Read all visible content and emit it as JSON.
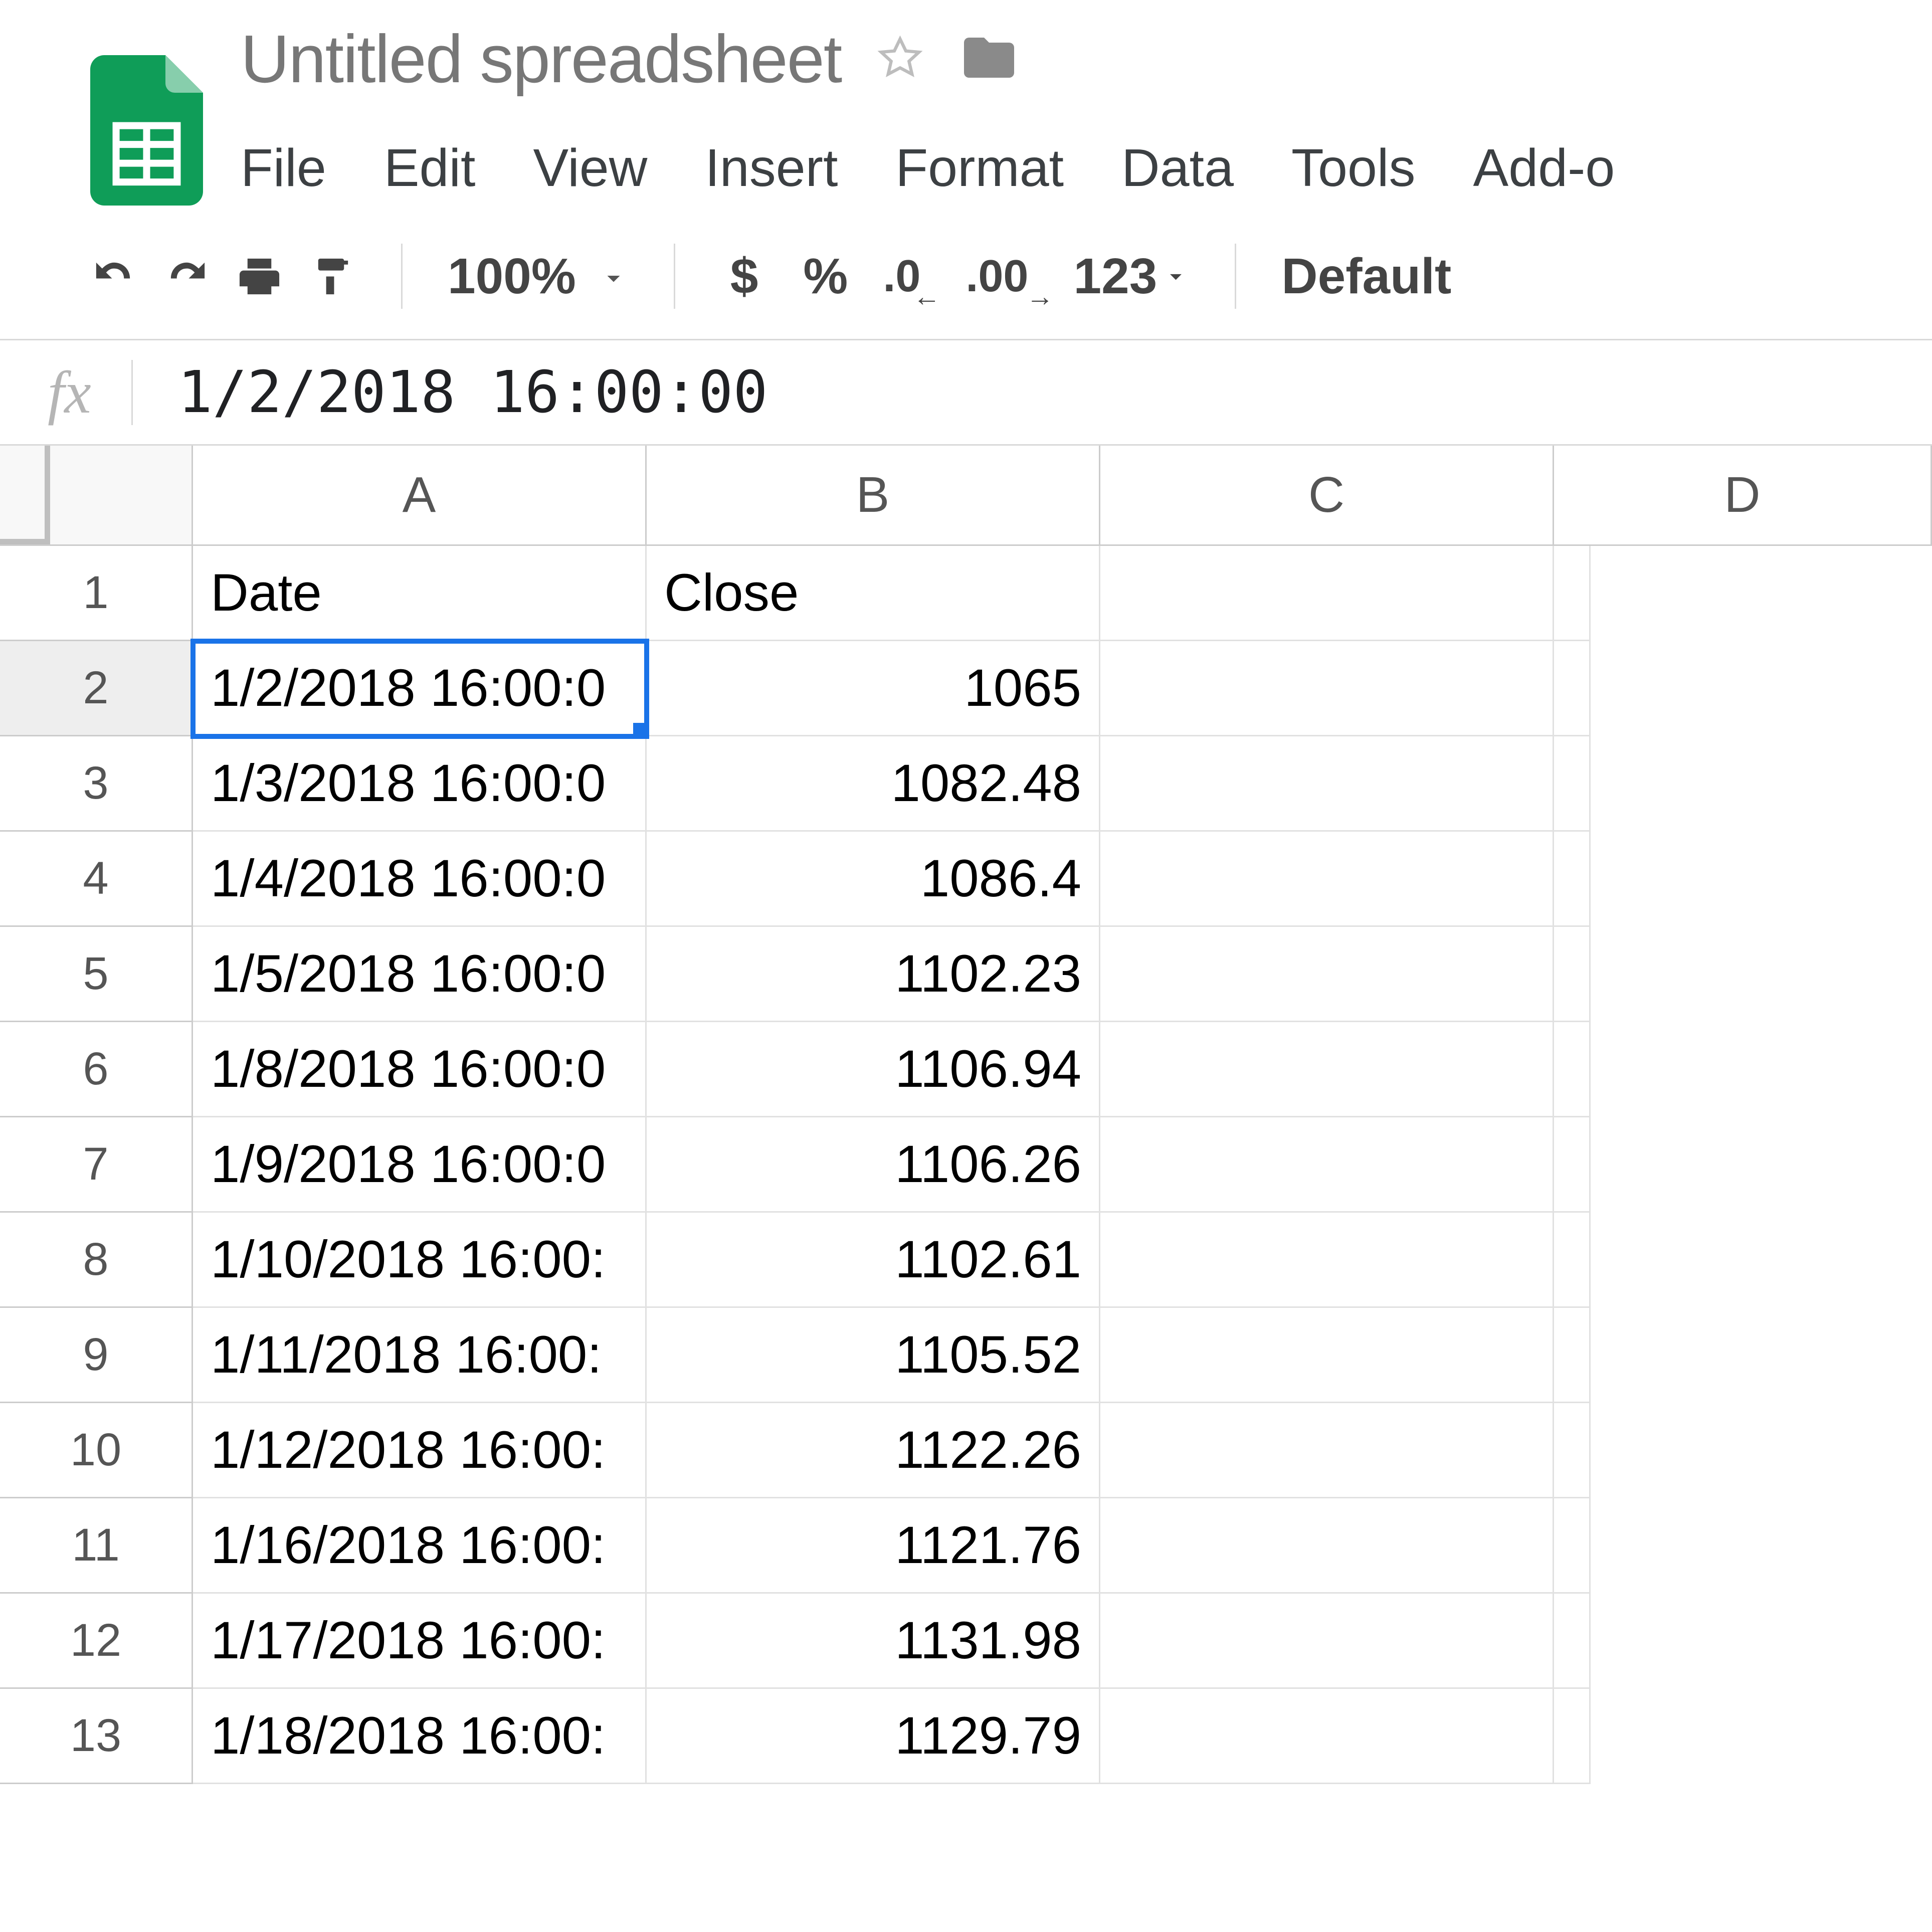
{
  "doc": {
    "name": "Untitled spreadsheet"
  },
  "menu": {
    "file": "File",
    "edit": "Edit",
    "view": "View",
    "insert": "Insert",
    "format": "Format",
    "data": "Data",
    "tools": "Tools",
    "addons": "Add-o"
  },
  "toolbar": {
    "zoom": "100%",
    "currency": "$",
    "percent": "%",
    "decrease_dec": ".0",
    "increase_dec": ".00",
    "more_formats": "123",
    "font": "Default"
  },
  "formula_bar": {
    "fx": "fx",
    "value": "1/2/2018 16:00:00"
  },
  "columns": {
    "A": "A",
    "B": "B",
    "C": "C",
    "D": "D"
  },
  "selected_cell": "A2",
  "rows": [
    {
      "n": "1",
      "a": "Date",
      "b": "Close",
      "sel": false,
      "b_align": "left"
    },
    {
      "n": "2",
      "a": "1/2/2018 16:00:0",
      "b": "1065",
      "sel": true
    },
    {
      "n": "3",
      "a": "1/3/2018 16:00:0",
      "b": "1082.48",
      "sel": false
    },
    {
      "n": "4",
      "a": "1/4/2018 16:00:0",
      "b": "1086.4",
      "sel": false
    },
    {
      "n": "5",
      "a": "1/5/2018 16:00:0",
      "b": "1102.23",
      "sel": false
    },
    {
      "n": "6",
      "a": "1/8/2018 16:00:0",
      "b": "1106.94",
      "sel": false
    },
    {
      "n": "7",
      "a": "1/9/2018 16:00:0",
      "b": "1106.26",
      "sel": false
    },
    {
      "n": "8",
      "a": "1/10/2018 16:00:",
      "b": "1102.61",
      "sel": false
    },
    {
      "n": "9",
      "a": "1/11/2018 16:00:",
      "b": "1105.52",
      "sel": false
    },
    {
      "n": "10",
      "a": "1/12/2018 16:00:",
      "b": "1122.26",
      "sel": false
    },
    {
      "n": "11",
      "a": "1/16/2018 16:00:",
      "b": "1121.76",
      "sel": false
    },
    {
      "n": "12",
      "a": "1/17/2018 16:00:",
      "b": "1131.98",
      "sel": false
    },
    {
      "n": "13",
      "a": "1/18/2018 16:00:",
      "b": "1129.79",
      "sel": false
    }
  ]
}
